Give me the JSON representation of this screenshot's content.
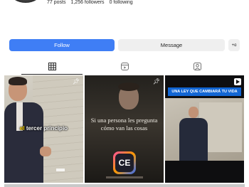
{
  "profile": {
    "posts": "77 posts",
    "followers": "1,256 followers",
    "following": "0 following"
  },
  "actions": {
    "follow_label": "Follow",
    "message_label": "Message",
    "suggest_label": "+ɑ"
  },
  "tabs": [
    {
      "icon": "grid-icon",
      "active": true
    },
    {
      "icon": "reels-icon",
      "active": false
    },
    {
      "icon": "tagged-icon",
      "active": false
    }
  ],
  "posts": [
    {
      "caption_highlight": "el",
      "caption": " tercer principio",
      "icon": "pin-icon"
    },
    {
      "caption": "Si una persona les pregunta cómo van las cosas",
      "logo_text": "CE",
      "icon": "pin-icon"
    },
    {
      "banner": "UNA LEY QUE CAMBIARÁ TU VIDA",
      "icon": "reel-icon"
    }
  ],
  "colors": {
    "follow_button": "#3f7ef5",
    "secondary_button": "#efefef",
    "banner": "#1266d4",
    "caption_highlight": "#ffd400"
  }
}
